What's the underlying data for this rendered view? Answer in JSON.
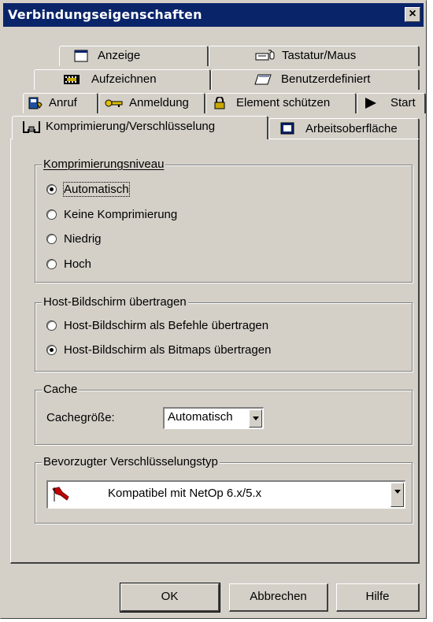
{
  "window": {
    "title": "Verbindungseigenschaften",
    "close_label": "×"
  },
  "tabs": {
    "row1": [
      {
        "label": "Anzeige",
        "icon": "window-icon"
      },
      {
        "label": "Tastatur/Maus",
        "icon": "keyboard-mouse-icon"
      }
    ],
    "row2": [
      {
        "label": "Aufzeichnen",
        "icon": "film-icon"
      },
      {
        "label": "Benutzerdefiniert",
        "icon": "custom-icon"
      }
    ],
    "row3": [
      {
        "label": "Anruf",
        "icon": "phone-book-icon"
      },
      {
        "label": "Anmeldung",
        "icon": "key-icon"
      },
      {
        "label": "Element schützen",
        "icon": "lock-icon"
      },
      {
        "label": "Start",
        "icon": "play-icon"
      }
    ],
    "row4": [
      {
        "label": "Komprimierung/Verschlüsselung",
        "icon": "clamp-icon",
        "active": true
      },
      {
        "label": "Arbeitsoberfläche",
        "icon": "desktop-icon"
      }
    ]
  },
  "compression": {
    "legend": "Komprimierungsniveau",
    "options": [
      "Automatisch",
      "Keine Komprimierung",
      "Niedrig",
      "Hoch"
    ],
    "selected": "Automatisch"
  },
  "host_screen": {
    "legend": "Host-Bildschirm übertragen",
    "options": [
      "Host-Bildschirm als Befehle übertragen",
      "Host-Bildschirm als Bitmaps übertragen"
    ],
    "selected": "Host-Bildschirm als Bitmaps übertragen"
  },
  "cache": {
    "legend": "Cache",
    "size_label": "Cachegröße:",
    "size_value": "Automatisch"
  },
  "encryption": {
    "legend": "Bevorzugter Verschlüsselungstyp",
    "value": "Kompatibel mit NetOp 6.x/5.x"
  },
  "buttons": {
    "ok": "OK",
    "cancel": "Abbrechen",
    "help": "Hilfe"
  },
  "colors": {
    "titlebar": "#0a246a",
    "face": "#d4d0c8"
  }
}
